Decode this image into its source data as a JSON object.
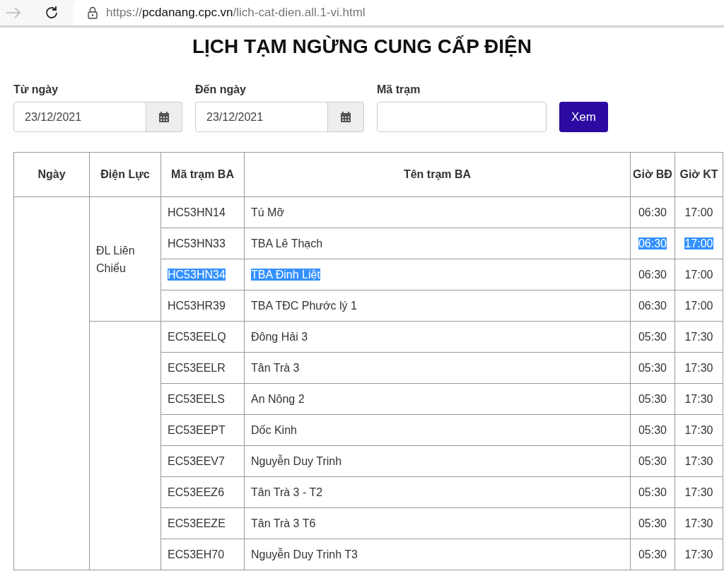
{
  "browser": {
    "url_prefix": "https://",
    "url_host": "pcdanang.cpc.vn",
    "url_path": "/lich-cat-dien.all.1-vi.html"
  },
  "title": "LỊCH TẠM NGỪNG CUNG CẤP ĐIỆN",
  "filters": {
    "from": {
      "label": "Từ ngày",
      "value": "23/12/2021"
    },
    "to": {
      "label": "Đến ngày",
      "value": "23/12/2021"
    },
    "station": {
      "label": "Mã trạm"
    },
    "button": "Xem"
  },
  "table": {
    "columns": [
      "Ngày",
      "Điện Lực",
      "Mã trạm BA",
      "Tên trạm BA",
      "Giờ BĐ",
      "Giờ KT"
    ],
    "groups": [
      {
        "dien_luc": "ĐL Liên Chiểu",
        "rows": [
          {
            "cells": [
              {
                "text": "HC53HN14",
                "highlighted": false
              },
              {
                "text": "Tú Mỡ",
                "highlighted": false
              },
              {
                "text": "06:30",
                "highlighted": false
              },
              {
                "text": "17:00",
                "highlighted": false
              }
            ]
          },
          {
            "cells": [
              {
                "text": "HC53HN33",
                "highlighted": false
              },
              {
                "text": "TBA Lê Thạch",
                "highlighted": false
              },
              {
                "text": "06:30",
                "highlighted": true
              },
              {
                "text": "17:00",
                "highlighted": true
              }
            ]
          },
          {
            "cells": [
              {
                "text": "HC53HN34",
                "highlighted": true
              },
              {
                "text": "TBA Đinh Liệt",
                "highlighted": true
              },
              {
                "text": "06:30",
                "highlighted": false
              },
              {
                "text": "17:00",
                "highlighted": false
              }
            ]
          },
          {
            "cells": [
              {
                "text": "HC53HR39",
                "highlighted": false
              },
              {
                "text": "TBA TĐC Phước lý 1",
                "highlighted": false
              },
              {
                "text": "06:30",
                "highlighted": false
              },
              {
                "text": "17:00",
                "highlighted": false
              }
            ]
          }
        ]
      },
      {
        "rows": [
          {
            "cells": [
              {
                "text": "EC53EELQ",
                "highlighted": false
              },
              {
                "text": "Đông Hải 3",
                "highlighted": false
              },
              {
                "text": "05:30",
                "highlighted": false
              },
              {
                "text": "17:30",
                "highlighted": false
              }
            ]
          },
          {
            "cells": [
              {
                "text": "EC53EELR",
                "highlighted": false
              },
              {
                "text": "Tân Trà 3",
                "highlighted": false
              },
              {
                "text": "05:30",
                "highlighted": false
              },
              {
                "text": "17:30",
                "highlighted": false
              }
            ]
          },
          {
            "cells": [
              {
                "text": "EC53EELS",
                "highlighted": false
              },
              {
                "text": "An Nông 2",
                "highlighted": false
              },
              {
                "text": "05:30",
                "highlighted": false
              },
              {
                "text": "17:30",
                "highlighted": false
              }
            ]
          },
          {
            "cells": [
              {
                "text": "EC53EEPT",
                "highlighted": false
              },
              {
                "text": "Dốc Kinh",
                "highlighted": false
              },
              {
                "text": "05:30",
                "highlighted": false
              },
              {
                "text": "17:30",
                "highlighted": false
              }
            ]
          },
          {
            "cells": [
              {
                "text": "EC53EEV7",
                "highlighted": false
              },
              {
                "text": "Nguyễn Duy Trinh",
                "highlighted": false
              },
              {
                "text": "05:30",
                "highlighted": false
              },
              {
                "text": "17:30",
                "highlighted": false
              }
            ]
          },
          {
            "cells": [
              {
                "text": "EC53EEZ6",
                "highlighted": false
              },
              {
                "text": "Tân Trà 3 - T2",
                "highlighted": false
              },
              {
                "text": "05:30",
                "highlighted": false
              },
              {
                "text": "17:30",
                "highlighted": false
              }
            ]
          },
          {
            "cells": [
              {
                "text": "EC53EEZE",
                "highlighted": false
              },
              {
                "text": "Tân Trà 3 T6",
                "highlighted": false
              },
              {
                "text": "05:30",
                "highlighted": false
              },
              {
                "text": "17:30",
                "highlighted": false
              }
            ]
          },
          {
            "cells": [
              {
                "text": "EC53EH70",
                "highlighted": false
              },
              {
                "text": "Nguyễn Duy Trinh T3",
                "highlighted": false
              },
              {
                "text": "05:30",
                "highlighted": false
              },
              {
                "text": "17:30",
                "highlighted": false
              }
            ]
          }
        ]
      }
    ]
  }
}
